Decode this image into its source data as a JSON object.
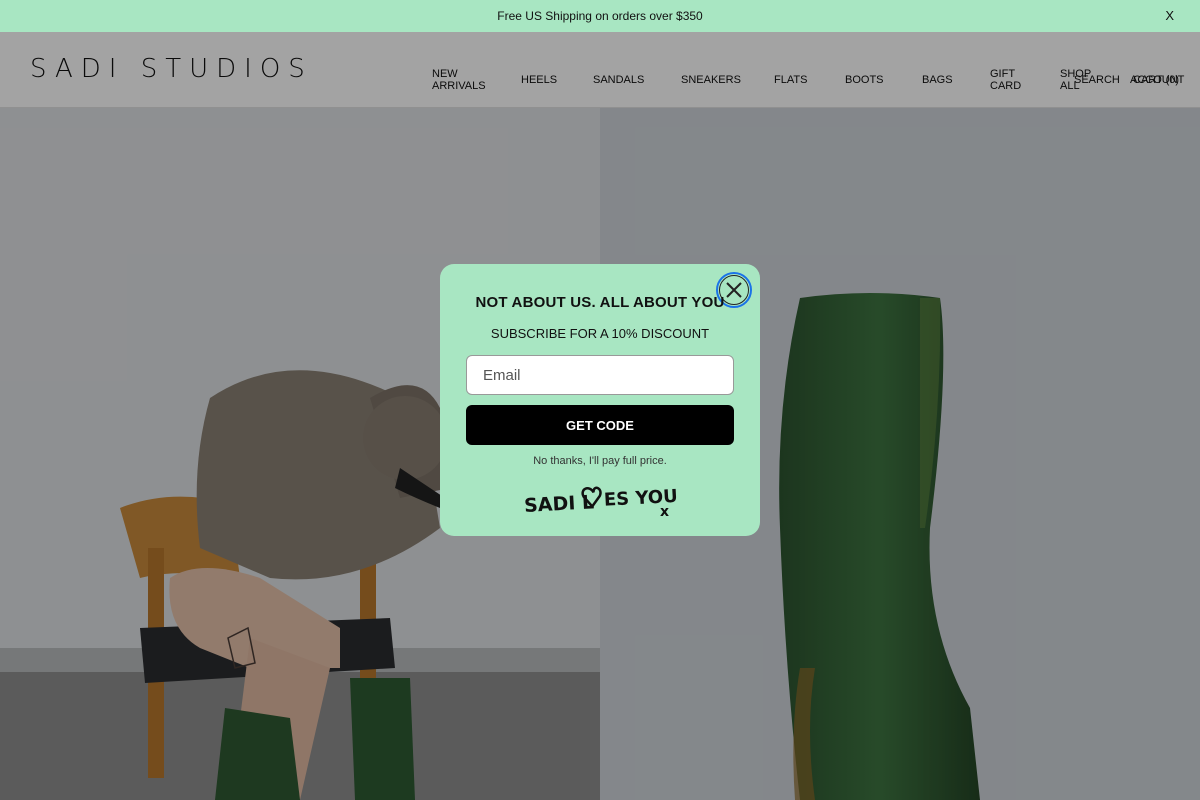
{
  "announcement": {
    "text": "Free US Shipping on orders over $350",
    "close_label": "X"
  },
  "header": {
    "logo": "SADI STUDIOS",
    "nav": [
      {
        "label": "NEW ARRIVALS"
      },
      {
        "label": "HEELS"
      },
      {
        "label": "SANDALS"
      },
      {
        "label": "SNEAKERS"
      },
      {
        "label": "FLATS"
      },
      {
        "label": "BOOTS"
      },
      {
        "label": "BAGS"
      },
      {
        "label": "GIFT CARD"
      },
      {
        "label": "SHOP ALL"
      }
    ],
    "search_label": "SEARCH",
    "account_label": "ACCOUNT",
    "cart_label": "CART (0)"
  },
  "popup": {
    "title": "NOT ABOUT US. ALL ABOUT YOU",
    "subtitle": "SUBSCRIBE FOR A 10% DISCOUNT",
    "email_placeholder": "Email",
    "button_label": "GET CODE",
    "decline_label": "No thanks, I'll pay full price.",
    "signature": "SADI LOVES YOU x"
  },
  "colors": {
    "accent": "#a8e6c2",
    "button": "#000000",
    "focus_ring": "#1a73e8"
  }
}
